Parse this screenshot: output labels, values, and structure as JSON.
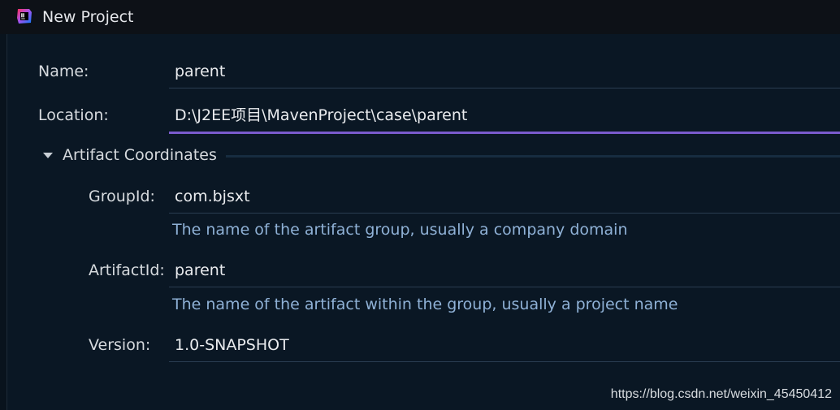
{
  "window": {
    "title": "New Project",
    "app_icon": "intellij-idea-icon"
  },
  "form": {
    "name": {
      "label": "Name:",
      "value": "parent"
    },
    "location": {
      "label": "Location:",
      "value": "D:\\J2EE项目\\MavenProject\\case\\parent"
    },
    "artifact_section": {
      "title": "Artifact Coordinates",
      "expanded": true,
      "toggle_icon": "triangle-down-icon"
    },
    "group_id": {
      "label": "GroupId:",
      "value": "com.bjsxt",
      "hint": "The name of the artifact group, usually a company domain"
    },
    "artifact_id": {
      "label": "ArtifactId:",
      "value": "parent",
      "hint": "The name of the artifact within the group, usually a project name"
    },
    "version": {
      "label": "Version:",
      "value": "1.0-SNAPSHOT"
    }
  },
  "watermark": "https://blog.csdn.net/weixin_45450412",
  "colors": {
    "background": "#0a1724",
    "titlebar": "#0d1117",
    "focus_underline": "#7a5bcd",
    "hint_text": "#8fb1d6",
    "field_border": "#2a3d51"
  }
}
